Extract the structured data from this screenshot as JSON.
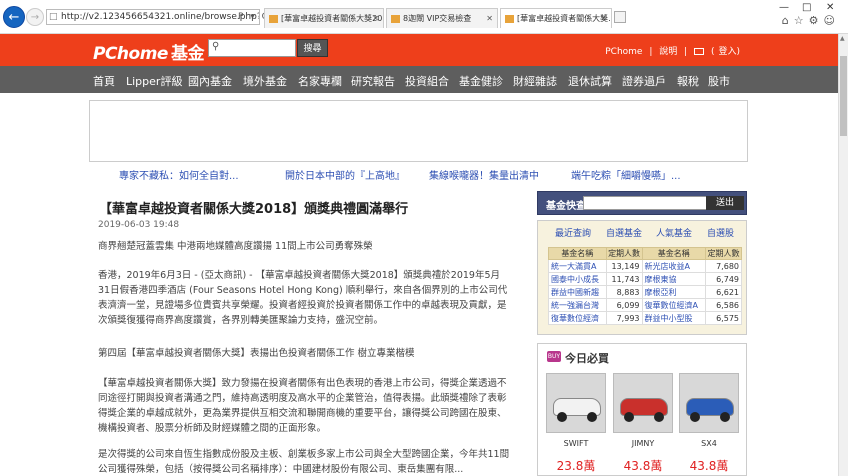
{
  "browser": {
    "address": "http://v2.123456654321.online/browse.php?u=swaUrbwR...",
    "address_tools": "P ▾ C ×",
    "tabs": [
      {
        "label": "[華富卓越投資者關係大獎20...",
        "active": false
      },
      {
        "label": "8迦閘 VIP交易檢查",
        "active": false
      },
      {
        "label": "[華富卓越投資者關係大獎...",
        "active": true
      }
    ],
    "window_controls": [
      "—",
      "□",
      "✕"
    ]
  },
  "header": {
    "logo": "PChome",
    "logo_suffix": "基金",
    "search_button": "搜尋",
    "top_links": [
      "PChome",
      "說明",
      "登入"
    ]
  },
  "menu": [
    "首頁",
    "Lipper評級",
    "國內基金",
    "境外基金",
    "名家專欄",
    "研究報告",
    "投資組合",
    "基金健診",
    "財經雜誌",
    "退休試算",
    "證券過戶",
    "報稅",
    "股市"
  ],
  "promos": [
    "專家不藏私：如何全自對...",
    "開於日本中部的『上高地』",
    "集線喉嚨器！集量出清中",
    "端午吃粽「細嚼慢嚥」..."
  ],
  "article": {
    "title": "【華富卓越投資者關係大獎2018】頒獎典禮圓滿舉行",
    "date": "2019-06-03 19:48",
    "paragraphs": [
      "商界翹楚冠蓋雲集 中港兩地媒體高度讚揚 11間上市公司勇奪殊榮",
      "香港，2019年6月3日 - (亞太商訊) - 【華富卓越投資者關係大獎2018】頒獎典禮於2019年5月31日假香港四季酒店 (Four Seasons Hotel Hong Kong) 順利舉行，來自各個界別的上市公司代表濟濟一堂，見證場多位貴賓共享榮耀。投資者經投資於投資者關係工作中的卓越表現及貢獻，是次頒獎復獲得商界高度讚賞，各界別轉美匯聚論力支持，盛況空前。",
      "第四屆【華富卓越投資者關係大獎】表揚出色投資者關係工作 樹立專業楷模",
      "【華富卓越投資者關係大獎】致力發揚在投資者關係有出色表現的香港上市公司，得獎企業透過不同途徑打開與投資者溝通之門，維持高透明度及高水平的企業管治，值得表揚。此頒獎禮除了表彰得獎企業的卓越成就外，更為業界提供互相交流和聯開商機的重要平台，讓得獎公司跨國在股東、機構投資者、股票分析師及財經媒體之間的正面形象。",
      "是次得獎的公司來自恆生指數成份股及主板、創業板多家上市公司與全大型跨國企業，今年共11間公司獲得殊榮，包括（按得獎公司名稱排序）：中國建材股份有限公司、東岳集團有限..."
    ]
  },
  "fund_search": {
    "label": "基金快查",
    "button": "送出"
  },
  "rank": {
    "tabs": [
      "最近查詢",
      "自選基金",
      "人氣基金",
      "自選股"
    ],
    "headers": [
      "基金名稱",
      "定期人數",
      "基金名稱",
      "定期人數"
    ],
    "rows": [
      [
        "統一大滿貫A",
        "13,149",
        "新光店收益A",
        "7,680"
      ],
      [
        "國泰中小成長",
        "11,743",
        "摩根東協",
        "6,749"
      ],
      [
        "群益中國新趨",
        "8,883",
        "摩根亞利",
        "6,621"
      ],
      [
        "統一強漏台灣",
        "6,099",
        "復華數位經濟A",
        "6,586"
      ],
      [
        "復華數位經濟",
        "7,993",
        "群益中小型股",
        "6,575"
      ]
    ]
  },
  "must_buy": {
    "badge": "BUY",
    "title": "今日必買",
    "items": [
      {
        "name": "SWIFT",
        "price": "23.8萬",
        "color": "#f2f2f2"
      },
      {
        "name": "JIMNY",
        "price": "43.8萬",
        "color": "#c9302c"
      },
      {
        "name": "SX4",
        "price": "43.8萬",
        "color": "#2b5db8"
      }
    ]
  }
}
